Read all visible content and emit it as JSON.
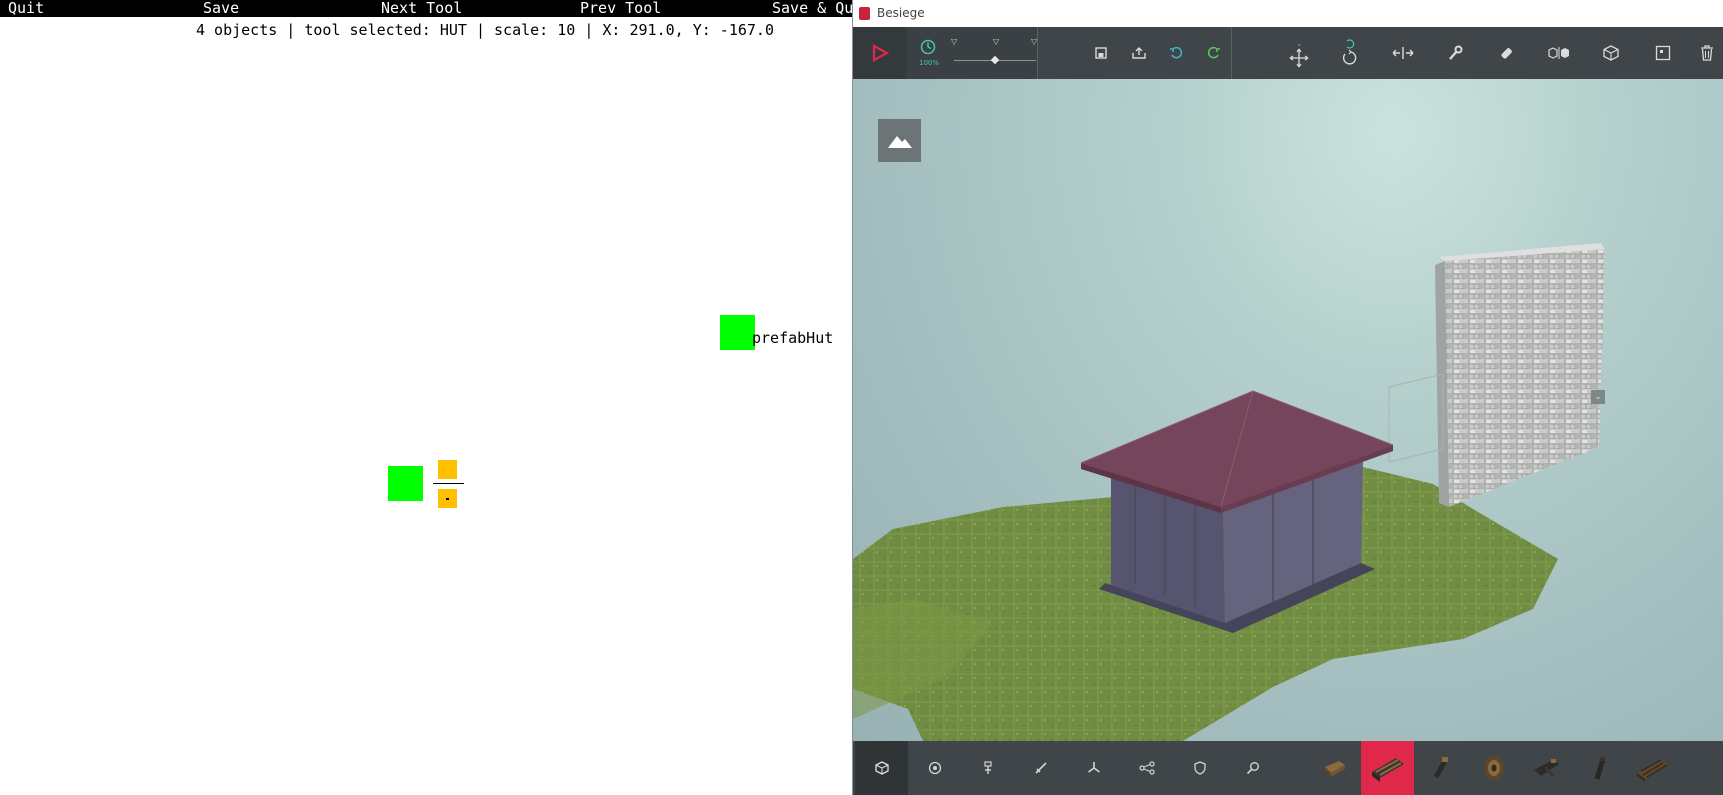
{
  "editor": {
    "menu": {
      "quit": "Quit",
      "save": "Save",
      "next_tool": "Next Tool",
      "prev_tool": "Prev Tool",
      "save_quit": "Save & Quit"
    },
    "status": "4 objects | tool selected: HUT | scale: 10 | X: 291.0, Y: -167.0",
    "objects": {
      "prefab_label": "prefabHut"
    },
    "colors": {
      "green": "#00ff00",
      "amber": "#ffc000"
    }
  },
  "game": {
    "window_title": "Besiege",
    "toolbar": {
      "icons": [
        "play-icon",
        "sim-speed-icon",
        "save-icon",
        "load-icon",
        "undo-icon",
        "redo-icon",
        "translate-icon",
        "rotate-icon",
        "flip-icon",
        "wrench-icon",
        "eraser-icon",
        "mirror-icon",
        "cube-view-icon",
        "key-mapper-icon",
        "trash-icon"
      ],
      "sim_speed": "100%"
    },
    "bottombar": {
      "categories": [
        "basic-blocks-icon",
        "wheels-icon",
        "mechanical-icon",
        "weapons-icon",
        "flight-icon",
        "automation-icon",
        "armour-icon",
        "search-icon"
      ],
      "selected_block_index": 1
    },
    "accent": "#e0284a"
  }
}
